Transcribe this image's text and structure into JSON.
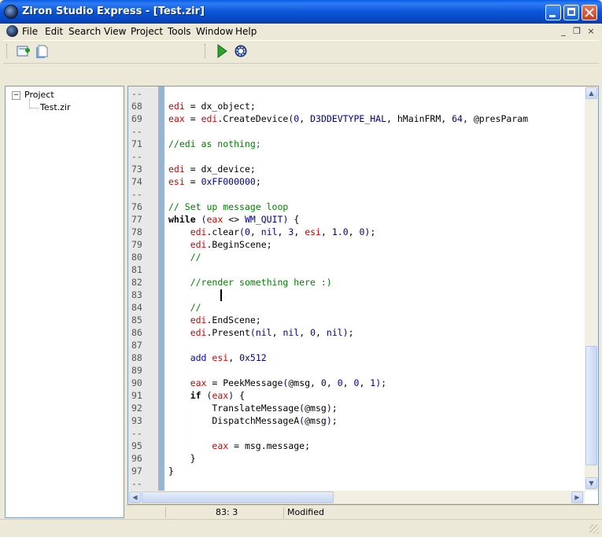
{
  "window": {
    "title": "Ziron Studio Express - [Test.zir]"
  },
  "menu": [
    "File",
    "Edit",
    "Search",
    "View",
    "Project",
    "Tools",
    "Window",
    "Help"
  ],
  "mdi_controls": [
    "_",
    "❐",
    "×"
  ],
  "project_tree": {
    "root": "Project",
    "children": [
      "Test.zir"
    ]
  },
  "colors": {
    "keyword_var": "#cc0000",
    "number": "#000088",
    "comment": "#008000",
    "keyword": "#000000",
    "add_kw": "#0000cc",
    "fold_bar": "#99b4d1"
  },
  "code_lines": [
    {
      "num": "--",
      "text": ""
    },
    {
      "num": "68",
      "text": "edi = dx_object;"
    },
    {
      "num": "69",
      "text": "eax = edi.CreateDevice(0, D3DDEVTYPE_HAL, hMainFRM, 64, @presParam"
    },
    {
      "num": "--",
      "text": ""
    },
    {
      "num": "71",
      "text": "//edi as nothing;"
    },
    {
      "num": "--",
      "text": ""
    },
    {
      "num": "73",
      "text": "edi = dx_device;"
    },
    {
      "num": "74",
      "text": "esi = 0xFF000000;"
    },
    {
      "num": "--",
      "text": ""
    },
    {
      "num": "76",
      "text": "// Set up message loop"
    },
    {
      "num": "77",
      "text": "while (eax <> WM_QUIT) {"
    },
    {
      "num": "78",
      "text": "    edi.clear(0, nil, 3, esi, 1.0, 0);"
    },
    {
      "num": "79",
      "text": "    edi.BeginScene;"
    },
    {
      "num": "80",
      "text": "    //"
    },
    {
      "num": "81",
      "text": ""
    },
    {
      "num": "82",
      "text": "    //render something here :)"
    },
    {
      "num": "83",
      "text": ""
    },
    {
      "num": "84",
      "text": "    //"
    },
    {
      "num": "85",
      "text": "    edi.EndScene;"
    },
    {
      "num": "86",
      "text": "    edi.Present(nil, nil, 0, nil);"
    },
    {
      "num": "87",
      "text": ""
    },
    {
      "num": "88",
      "text": "    add esi, 0x512"
    },
    {
      "num": "89",
      "text": ""
    },
    {
      "num": "90",
      "text": "    eax = PeekMessage(@msg, 0, 0, 0, 1);"
    },
    {
      "num": "91",
      "text": "    if (eax) {"
    },
    {
      "num": "92",
      "text": "        TranslateMessage(@msg);"
    },
    {
      "num": "93",
      "text": "        DispatchMessageA(@msg);"
    },
    {
      "num": "--",
      "text": ""
    },
    {
      "num": "95",
      "text": "        eax = msg.message;"
    },
    {
      "num": "96",
      "text": "    }"
    },
    {
      "num": "97",
      "text": "}"
    },
    {
      "num": "--",
      "text": ""
    }
  ],
  "status": {
    "position": "83: 3",
    "state": "Modified"
  }
}
